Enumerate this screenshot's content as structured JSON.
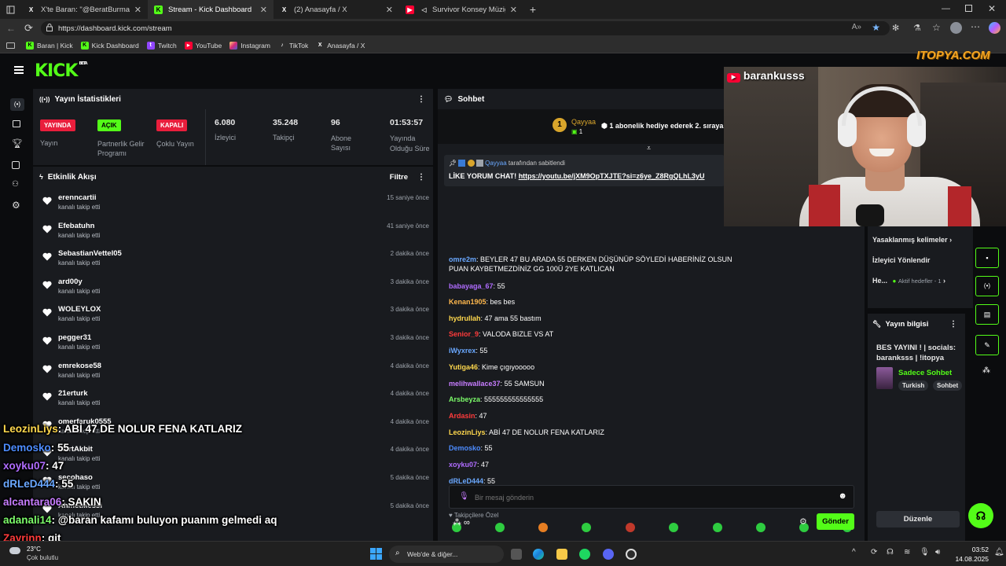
{
  "browser": {
    "tabs": [
      {
        "title": "X'te Baran: \"@BeratBurma @eray",
        "icon": "x-logo-icon"
      },
      {
        "title": "Stream - Kick Dashboard",
        "icon": "kick-logo-icon",
        "active": true
      },
      {
        "title": "(2) Anasayfa / X",
        "icon": "x-logo-icon"
      },
      {
        "title": "Survivor Konsey Müziği (Uz",
        "icon": "youtube-icon"
      }
    ],
    "url": "https://dashboard.kick.com/stream",
    "bookmarks": [
      {
        "label": "Baran | Kick",
        "icon": "kick-logo-icon"
      },
      {
        "label": "Kick Dashboard",
        "icon": "kick-logo-icon"
      },
      {
        "label": "Twitch",
        "icon": "twitch-icon"
      },
      {
        "label": "YouTube",
        "icon": "youtube-icon"
      },
      {
        "label": "Instagram",
        "icon": "instagram-icon"
      },
      {
        "label": "TikTok",
        "icon": "tiktok-icon"
      },
      {
        "label": "Anasayfa / X",
        "icon": "x-logo-icon"
      }
    ]
  },
  "kick": {
    "logo": "KICK",
    "logo_badge": "BETA",
    "stats": {
      "title": "Yayın İstatistikleri",
      "items": [
        {
          "badge": "YAYINDA",
          "label": "Yayın",
          "color": "#e91e3c"
        },
        {
          "badge": "AÇIK",
          "label": "Partnerlik Gelir Programı",
          "color": "#53fc18"
        },
        {
          "badge": "KAPALI",
          "label": "Çoklu Yayın",
          "color": "#e91e3c"
        }
      ],
      "numbers": [
        {
          "value": "6.080",
          "label": "İzleyici"
        },
        {
          "value": "35.248",
          "label": "Takipçi"
        },
        {
          "value": "96",
          "label": "Abone Sayısı"
        },
        {
          "value": "01:53:57",
          "label": "Yayında Olduğu Süre"
        }
      ]
    },
    "activity": {
      "title": "Etkinlik Akışı",
      "filter": "Filtre",
      "rows": [
        {
          "name": "erenncartii",
          "sub": "kanalı takip etti",
          "time": "15 saniye önce"
        },
        {
          "name": "Efebatuhn",
          "sub": "kanalı takip etti",
          "time": "41 saniye önce"
        },
        {
          "name": "SebastianVettel05",
          "sub": "kanalı takip etti",
          "time": "2 dakika önce"
        },
        {
          "name": "ard00y",
          "sub": "kanalı takip etti",
          "time": "3 dakika önce"
        },
        {
          "name": "WOLEYLOX",
          "sub": "kanalı takip etti",
          "time": "3 dakika önce"
        },
        {
          "name": "pegger31",
          "sub": "kanalı takip etti",
          "time": "3 dakika önce"
        },
        {
          "name": "emrekose58",
          "sub": "kanalı takip etti",
          "time": "4 dakika önce"
        },
        {
          "name": "21erturk",
          "sub": "kanalı takip etti",
          "time": "4 dakika önce"
        },
        {
          "name": "omerfaruk0555",
          "sub": "kanalı takip etti",
          "time": "4 dakika önce"
        },
        {
          "name": "MertAkbit",
          "sub": "kanalı takip etti",
          "time": "4 dakika önce"
        },
        {
          "name": "secohaso",
          "sub": "kanalı takip etti",
          "time": "5 dakika önce"
        },
        {
          "name": "AhmetMessi",
          "sub": "kanalı takip etti",
          "time": "5 dakika önce"
        }
      ]
    },
    "chat": {
      "title": "Sohbet",
      "top_gifter_name": "Qayyaa",
      "top_gifter_count": "1",
      "gift_text": "1 abonelik hediye ederek 2. sıraya",
      "pinned_by_user": "Qayyaa",
      "pinned_by_text": "tarafından sabitlendi",
      "pinned_text": "LİKE YORUM CHAT!",
      "pinned_link": "https://youtu.be/jXM9OpTXJTE?si=z6ye_Z8RgQLhL3yU",
      "messages": [
        {
          "user": "omre2m",
          "text": "BEYLER 47 BU ARADA 55 DERKEN DÜŞÜNÜP SÖYLEDİ HABERİNİZ OLSUN",
          "text2": "PUAN KAYBETMEZDİNİZ GG 100Ü 2YE KATLICAN",
          "color": "#6aa8ff"
        },
        {
          "user": "babayaga_67",
          "text": "55",
          "color": "#b06cff"
        },
        {
          "user": "Kenan1905",
          "text": "bes bes",
          "color": "#ffb84d"
        },
        {
          "user": "hydrullah",
          "text": "47 ama 55 bastım",
          "color": "#ffd84d"
        },
        {
          "user": "Senior_9",
          "text": "VALODA BIZLE VS AT",
          "color": "#ff3b3b"
        },
        {
          "user": "iWyxrex",
          "text": "55",
          "color": "#6aa8ff"
        },
        {
          "user": "Yutiga46",
          "text": "Kime çıgıyooooo",
          "color": "#ffd84d"
        },
        {
          "user": "melihwallace37",
          "text": "55 SAMSUN",
          "color": "#c77dff"
        },
        {
          "user": "Arsbeyza",
          "text": "555555555555555",
          "color": "#7cfc6a"
        },
        {
          "user": "Ardasin",
          "text": "47",
          "color": "#ff3b3b"
        },
        {
          "user": "LeozinLiys",
          "text": "ABİ 47 DE NOLUR FENA KATLARIZ",
          "color": "#ffd84d"
        },
        {
          "user": "Demosko",
          "text": "55",
          "color": "#4d8cff"
        },
        {
          "user": "xoyku07",
          "text": "47",
          "color": "#b06cff"
        },
        {
          "user": "dRLeD444",
          "text": "55",
          "color": "#6aa8ff"
        },
        {
          "user": "alcantara06",
          "text": "SAKIN",
          "color": "#c77dff"
        }
      ],
      "followers_only": "Takipçilere Özel",
      "input_placeholder": "Bir mesaj gönderin",
      "send_label": "Gönder"
    },
    "side": {
      "banned_words": "Yasaklanmış kelimeler",
      "viewer_director": "İzleyici Yönlendir",
      "goals_short": "He...",
      "goals_active": "Aktif hedefler - 1",
      "stream_info_title": "Yayın bilgisi",
      "stream_title": "BES YAYINI ! | socials: baranksss | !itopya",
      "category": "Sadece Sohbet",
      "tags": [
        "Turkish",
        "Sohbet"
      ],
      "edit_label": "Düzenle"
    }
  },
  "webcam": {
    "channel": "barankusss",
    "watermark": "ITOPYA.COM"
  },
  "overlay_chat": [
    {
      "user": "LeozinLiys",
      "text": ": ABİ 47 DE NOLUR FENA KATLARIZ",
      "color": "#ffd84d"
    },
    {
      "user": "Demosko",
      "text": ": 55",
      "color": "#4d8cff"
    },
    {
      "user": "xoyku07",
      "text": ": 47",
      "color": "#b06cff"
    },
    {
      "user": "dRLeD444",
      "text": ": 55",
      "color": "#6aa8ff"
    },
    {
      "user": "alcantara06",
      "text": ": SAKIN",
      "color": "#c77dff"
    },
    {
      "user": "adanali14",
      "text": ": @baran kafamı buluyon puanım gelmedi aq",
      "color": "#7cfc6a"
    },
    {
      "user": "Zayrinn",
      "text": ": git",
      "color": "#ff3b3b"
    }
  ],
  "taskbar": {
    "weather_temp": "23°C",
    "weather_text": "Çok bulutlu",
    "search_label": "Web'de & diğer...",
    "time": "03:52",
    "date": "14.08.2025"
  }
}
